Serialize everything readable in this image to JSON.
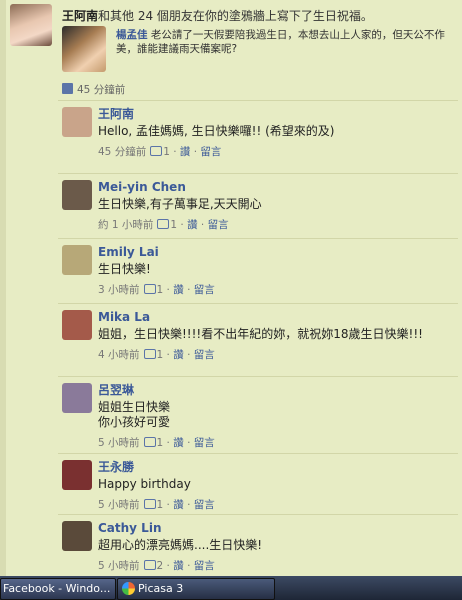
{
  "header": {
    "name": "王阿南",
    "text": "和其他 24 個朋友在你的塗鴉牆上寫下了生日祝福。"
  },
  "shared_post": {
    "author": "楊孟佳",
    "text": "老公請了一天假要陪我過生日，本想去山上人家的，但天公不作美，誰能建議雨天備案呢?"
  },
  "likes": {
    "time": "45 分鐘前"
  },
  "meta_labels": {
    "like": "讚",
    "reply": "留言"
  },
  "comments": [
    {
      "name": "王阿南",
      "text": "Hello, 孟佳媽媽, 生日快樂囉!! (希望來的及)",
      "time": "45 分鐘前",
      "count": "1",
      "avatar_color": "#c9a48a"
    },
    {
      "name": "Mei-yin Chen",
      "text": "生日快樂,有子萬事足,天天開心",
      "time": "約 1 小時前",
      "count": "1",
      "avatar_color": "#6b5a4a"
    },
    {
      "name": "Emily Lai",
      "text": "生日快樂!",
      "time": "3 小時前",
      "count": "1",
      "avatar_color": "#b7a878"
    },
    {
      "name": "Mika La",
      "text": "姐姐，生日快樂!!!!看不出年紀的妳，就祝妳18歲生日快樂!!!",
      "time": "4 小時前",
      "count": "1",
      "avatar_color": "#a45a4a"
    },
    {
      "name": "呂翌琳",
      "text": "姐姐生日快樂\n你小孩好可愛",
      "time": "5 小時前",
      "count": "1",
      "avatar_color": "#8a7a9a"
    },
    {
      "name": "王永勝",
      "text": "Happy birthday",
      "time": "5 小時前",
      "count": "1",
      "avatar_color": "#7a3030"
    },
    {
      "name": "Cathy Lin",
      "text": "超用心的漂亮媽媽....生日快樂!",
      "time": "5 小時前",
      "count": "2",
      "avatar_color": "#5a4a3a"
    }
  ],
  "taskbar": {
    "item1": "Facebook - Windo...",
    "item2": "Picasa 3"
  }
}
